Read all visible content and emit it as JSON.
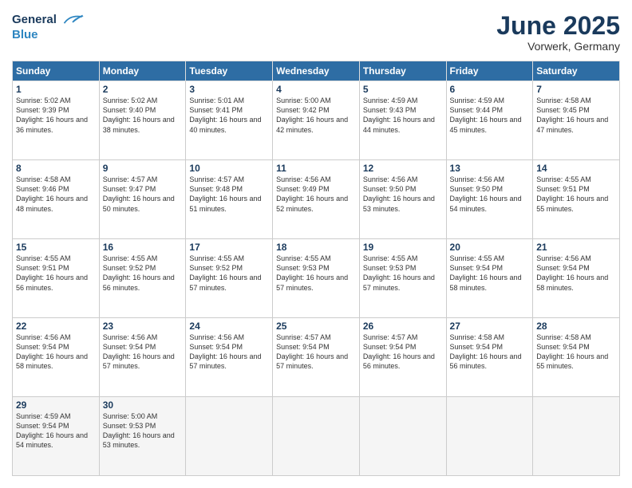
{
  "header": {
    "logo_line1": "General",
    "logo_line2": "Blue",
    "month": "June 2025",
    "location": "Vorwerk, Germany"
  },
  "days_of_week": [
    "Sunday",
    "Monday",
    "Tuesday",
    "Wednesday",
    "Thursday",
    "Friday",
    "Saturday"
  ],
  "weeks": [
    [
      {
        "day": "1",
        "rise": "5:02 AM",
        "set": "9:39 PM",
        "daylight": "16 hours and 36 minutes."
      },
      {
        "day": "2",
        "rise": "5:02 AM",
        "set": "9:40 PM",
        "daylight": "16 hours and 38 minutes."
      },
      {
        "day": "3",
        "rise": "5:01 AM",
        "set": "9:41 PM",
        "daylight": "16 hours and 40 minutes."
      },
      {
        "day": "4",
        "rise": "5:00 AM",
        "set": "9:42 PM",
        "daylight": "16 hours and 42 minutes."
      },
      {
        "day": "5",
        "rise": "4:59 AM",
        "set": "9:43 PM",
        "daylight": "16 hours and 44 minutes."
      },
      {
        "day": "6",
        "rise": "4:59 AM",
        "set": "9:44 PM",
        "daylight": "16 hours and 45 minutes."
      },
      {
        "day": "7",
        "rise": "4:58 AM",
        "set": "9:45 PM",
        "daylight": "16 hours and 47 minutes."
      }
    ],
    [
      {
        "day": "8",
        "rise": "4:58 AM",
        "set": "9:46 PM",
        "daylight": "16 hours and 48 minutes."
      },
      {
        "day": "9",
        "rise": "4:57 AM",
        "set": "9:47 PM",
        "daylight": "16 hours and 50 minutes."
      },
      {
        "day": "10",
        "rise": "4:57 AM",
        "set": "9:48 PM",
        "daylight": "16 hours and 51 minutes."
      },
      {
        "day": "11",
        "rise": "4:56 AM",
        "set": "9:49 PM",
        "daylight": "16 hours and 52 minutes."
      },
      {
        "day": "12",
        "rise": "4:56 AM",
        "set": "9:50 PM",
        "daylight": "16 hours and 53 minutes."
      },
      {
        "day": "13",
        "rise": "4:56 AM",
        "set": "9:50 PM",
        "daylight": "16 hours and 54 minutes."
      },
      {
        "day": "14",
        "rise": "4:55 AM",
        "set": "9:51 PM",
        "daylight": "16 hours and 55 minutes."
      }
    ],
    [
      {
        "day": "15",
        "rise": "4:55 AM",
        "set": "9:51 PM",
        "daylight": "16 hours and 56 minutes."
      },
      {
        "day": "16",
        "rise": "4:55 AM",
        "set": "9:52 PM",
        "daylight": "16 hours and 56 minutes."
      },
      {
        "day": "17",
        "rise": "4:55 AM",
        "set": "9:52 PM",
        "daylight": "16 hours and 57 minutes."
      },
      {
        "day": "18",
        "rise": "4:55 AM",
        "set": "9:53 PM",
        "daylight": "16 hours and 57 minutes."
      },
      {
        "day": "19",
        "rise": "4:55 AM",
        "set": "9:53 PM",
        "daylight": "16 hours and 57 minutes."
      },
      {
        "day": "20",
        "rise": "4:55 AM",
        "set": "9:54 PM",
        "daylight": "16 hours and 58 minutes."
      },
      {
        "day": "21",
        "rise": "4:56 AM",
        "set": "9:54 PM",
        "daylight": "16 hours and 58 minutes."
      }
    ],
    [
      {
        "day": "22",
        "rise": "4:56 AM",
        "set": "9:54 PM",
        "daylight": "16 hours and 58 minutes."
      },
      {
        "day": "23",
        "rise": "4:56 AM",
        "set": "9:54 PM",
        "daylight": "16 hours and 57 minutes."
      },
      {
        "day": "24",
        "rise": "4:56 AM",
        "set": "9:54 PM",
        "daylight": "16 hours and 57 minutes."
      },
      {
        "day": "25",
        "rise": "4:57 AM",
        "set": "9:54 PM",
        "daylight": "16 hours and 57 minutes."
      },
      {
        "day": "26",
        "rise": "4:57 AM",
        "set": "9:54 PM",
        "daylight": "16 hours and 56 minutes."
      },
      {
        "day": "27",
        "rise": "4:58 AM",
        "set": "9:54 PM",
        "daylight": "16 hours and 56 minutes."
      },
      {
        "day": "28",
        "rise": "4:58 AM",
        "set": "9:54 PM",
        "daylight": "16 hours and 55 minutes."
      }
    ],
    [
      {
        "day": "29",
        "rise": "4:59 AM",
        "set": "9:54 PM",
        "daylight": "16 hours and 54 minutes."
      },
      {
        "day": "30",
        "rise": "5:00 AM",
        "set": "9:53 PM",
        "daylight": "16 hours and 53 minutes."
      },
      null,
      null,
      null,
      null,
      null
    ]
  ]
}
